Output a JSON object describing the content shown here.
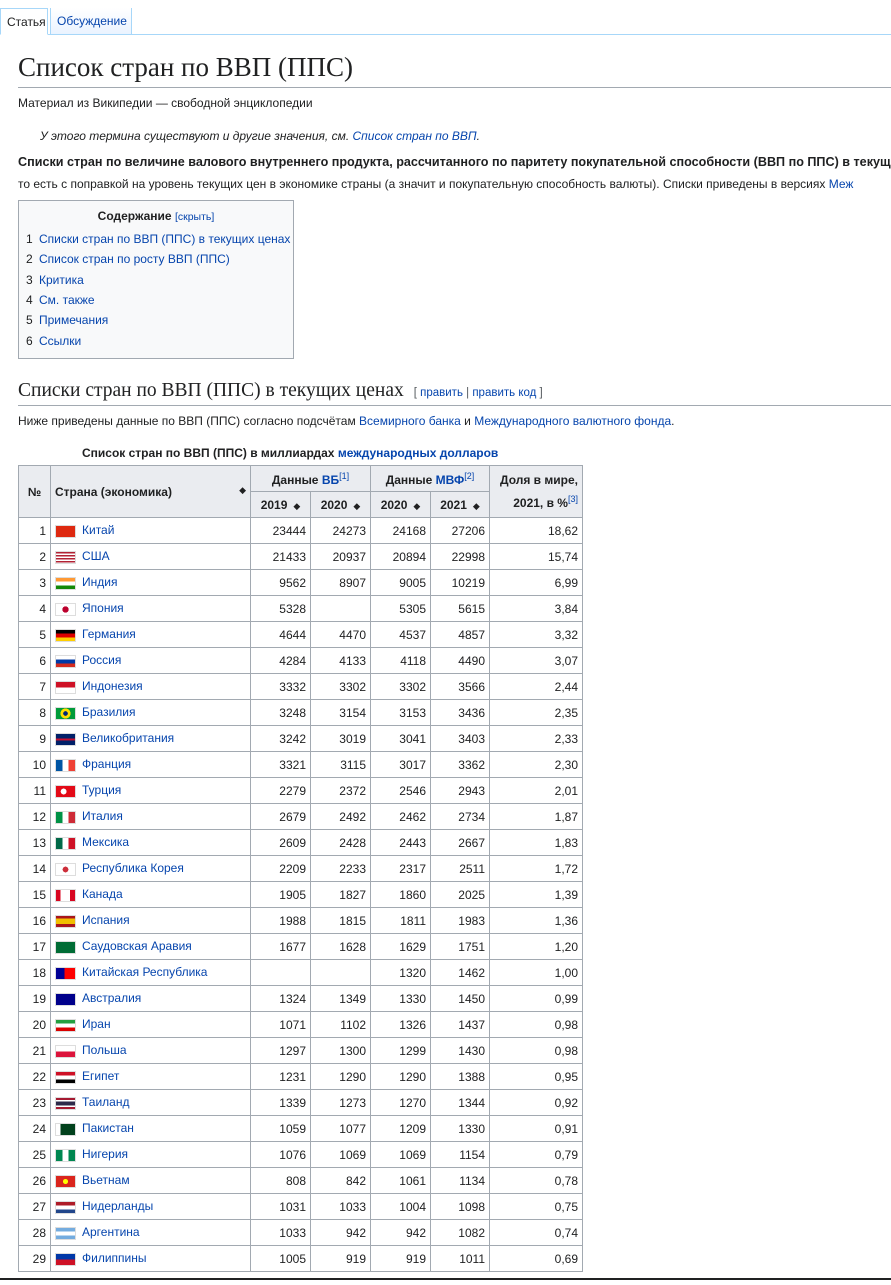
{
  "tabs": {
    "article": "Статья",
    "talk": "Обсуждение"
  },
  "title": "Список стран по ВВП (ППС)",
  "subtitle": "Материал из Википедии — свободной энциклопедии",
  "hatnote": {
    "text": "У этого термина существуют и другие значения, см. ",
    "link": "Список стран по ВВП",
    "end": "."
  },
  "lead": {
    "bold": "Списки стран по величине валового внутреннего продукта, рассчитанного по паритету покупательной способности (ВВП по ППС) в текущ",
    "line2": "то есть с поправкой на уровень текущих цен в экономике страны (а значит и покупательную способность валюты). Списки приведены в версиях ",
    "line2_link": "Меж"
  },
  "toc": {
    "title": "Содержание",
    "toggle": "[скрыть]",
    "items": [
      {
        "num": "1",
        "label": "Списки стран по ВВП (ППС) в текущих ценах"
      },
      {
        "num": "2",
        "label": "Список стран по росту ВВП (ППС)"
      },
      {
        "num": "3",
        "label": "Критика"
      },
      {
        "num": "4",
        "label": "См. также"
      },
      {
        "num": "5",
        "label": "Примечания"
      },
      {
        "num": "6",
        "label": "Ссылки"
      }
    ]
  },
  "section": {
    "heading": "Списки стран по ВВП (ППС) в текущих ценах",
    "edit_open": "[ ",
    "edit": "править",
    "sep": " | ",
    "edit_code": "править код",
    "edit_close": " ]",
    "para_start": "Ниже приведены данные по ВВП (ППС) согласно подсчётам ",
    "para_link1": "Всемирного банка",
    "para_mid": " и ",
    "para_link2": "Международного валютного фонда",
    "para_end": "."
  },
  "table": {
    "caption": "Список стран по ВВП (ППС) в миллиардах ",
    "caption_link": "международных долларов",
    "headers": {
      "num": "№",
      "country": "Страна (экономика)",
      "wb_prefix": "Данные ",
      "wb_link": "ВБ",
      "wb_ref": "[1]",
      "imf_prefix": "Данные ",
      "imf_link": "МВФ",
      "imf_ref": "[2]",
      "share": "Доля в мире, 2021, в %",
      "share_ref": "[3]",
      "y2019": "2019",
      "y2020a": "2020",
      "y2020b": "2020",
      "y2021": "2021"
    },
    "sort_icon": "◆",
    "rows": [
      {
        "n": "1",
        "country": "Китай",
        "flag": "cn",
        "wb2019": "23444",
        "wb2020": "24273",
        "imf2020": "24168",
        "imf2021": "27206",
        "share": "18,62"
      },
      {
        "n": "2",
        "country": "США",
        "flag": "us",
        "wb2019": "21433",
        "wb2020": "20937",
        "imf2020": "20894",
        "imf2021": "22998",
        "share": "15,74"
      },
      {
        "n": "3",
        "country": "Индия",
        "flag": "in",
        "wb2019": "9562",
        "wb2020": "8907",
        "imf2020": "9005",
        "imf2021": "10219",
        "share": "6,99"
      },
      {
        "n": "4",
        "country": "Япония",
        "flag": "jp",
        "wb2019": "5328",
        "wb2020": "",
        "imf2020": "5305",
        "imf2021": "5615",
        "share": "3,84"
      },
      {
        "n": "5",
        "country": "Германия",
        "flag": "de",
        "wb2019": "4644",
        "wb2020": "4470",
        "imf2020": "4537",
        "imf2021": "4857",
        "share": "3,32"
      },
      {
        "n": "6",
        "country": "Россия",
        "flag": "ru",
        "wb2019": "4284",
        "wb2020": "4133",
        "imf2020": "4118",
        "imf2021": "4490",
        "share": "3,07"
      },
      {
        "n": "7",
        "country": "Индонезия",
        "flag": "id",
        "wb2019": "3332",
        "wb2020": "3302",
        "imf2020": "3302",
        "imf2021": "3566",
        "share": "2,44"
      },
      {
        "n": "8",
        "country": "Бразилия",
        "flag": "br",
        "wb2019": "3248",
        "wb2020": "3154",
        "imf2020": "3153",
        "imf2021": "3436",
        "share": "2,35"
      },
      {
        "n": "9",
        "country": "Великобритания",
        "flag": "gb",
        "wb2019": "3242",
        "wb2020": "3019",
        "imf2020": "3041",
        "imf2021": "3403",
        "share": "2,33"
      },
      {
        "n": "10",
        "country": "Франция",
        "flag": "fr",
        "wb2019": "3321",
        "wb2020": "3115",
        "imf2020": "3017",
        "imf2021": "3362",
        "share": "2,30"
      },
      {
        "n": "11",
        "country": "Турция",
        "flag": "tr",
        "wb2019": "2279",
        "wb2020": "2372",
        "imf2020": "2546",
        "imf2021": "2943",
        "share": "2,01"
      },
      {
        "n": "12",
        "country": "Италия",
        "flag": "it",
        "wb2019": "2679",
        "wb2020": "2492",
        "imf2020": "2462",
        "imf2021": "2734",
        "share": "1,87"
      },
      {
        "n": "13",
        "country": "Мексика",
        "flag": "mx",
        "wb2019": "2609",
        "wb2020": "2428",
        "imf2020": "2443",
        "imf2021": "2667",
        "share": "1,83"
      },
      {
        "n": "14",
        "country": "Республика Корея",
        "flag": "kr",
        "wb2019": "2209",
        "wb2020": "2233",
        "imf2020": "2317",
        "imf2021": "2511",
        "share": "1,72"
      },
      {
        "n": "15",
        "country": "Канада",
        "flag": "ca",
        "wb2019": "1905",
        "wb2020": "1827",
        "imf2020": "1860",
        "imf2021": "2025",
        "share": "1,39"
      },
      {
        "n": "16",
        "country": "Испания",
        "flag": "es",
        "wb2019": "1988",
        "wb2020": "1815",
        "imf2020": "1811",
        "imf2021": "1983",
        "share": "1,36"
      },
      {
        "n": "17",
        "country": "Саудовская Аравия",
        "flag": "sa",
        "wb2019": "1677",
        "wb2020": "1628",
        "imf2020": "1629",
        "imf2021": "1751",
        "share": "1,20"
      },
      {
        "n": "18",
        "country": "Китайская Республика",
        "flag": "tw",
        "wb2019": "",
        "wb2020": "",
        "imf2020": "1320",
        "imf2021": "1462",
        "share": "1,00"
      },
      {
        "n": "19",
        "country": "Австралия",
        "flag": "au",
        "wb2019": "1324",
        "wb2020": "1349",
        "imf2020": "1330",
        "imf2021": "1450",
        "share": "0,99"
      },
      {
        "n": "20",
        "country": "Иран",
        "flag": "ir",
        "wb2019": "1071",
        "wb2020": "1102",
        "imf2020": "1326",
        "imf2021": "1437",
        "share": "0,98"
      },
      {
        "n": "21",
        "country": "Польша",
        "flag": "pl",
        "wb2019": "1297",
        "wb2020": "1300",
        "imf2020": "1299",
        "imf2021": "1430",
        "share": "0,98"
      },
      {
        "n": "22",
        "country": "Египет",
        "flag": "eg",
        "wb2019": "1231",
        "wb2020": "1290",
        "imf2020": "1290",
        "imf2021": "1388",
        "share": "0,95"
      },
      {
        "n": "23",
        "country": "Таиланд",
        "flag": "th",
        "wb2019": "1339",
        "wb2020": "1273",
        "imf2020": "1270",
        "imf2021": "1344",
        "share": "0,92"
      },
      {
        "n": "24",
        "country": "Пакистан",
        "flag": "pk",
        "wb2019": "1059",
        "wb2020": "1077",
        "imf2020": "1209",
        "imf2021": "1330",
        "share": "0,91"
      },
      {
        "n": "25",
        "country": "Нигерия",
        "flag": "ng",
        "wb2019": "1076",
        "wb2020": "1069",
        "imf2020": "1069",
        "imf2021": "1154",
        "share": "0,79"
      },
      {
        "n": "26",
        "country": "Вьетнам",
        "flag": "vn",
        "wb2019": "808",
        "wb2020": "842",
        "imf2020": "1061",
        "imf2021": "1134",
        "share": "0,78"
      },
      {
        "n": "27",
        "country": "Нидерланды",
        "flag": "nl",
        "wb2019": "1031",
        "wb2020": "1033",
        "imf2020": "1004",
        "imf2021": "1098",
        "share": "0,75"
      },
      {
        "n": "28",
        "country": "Аргентина",
        "flag": "ar",
        "wb2019": "1033",
        "wb2020": "942",
        "imf2020": "942",
        "imf2021": "1082",
        "share": "0,74"
      },
      {
        "n": "29",
        "country": "Филиппины",
        "flag": "ph",
        "wb2019": "1005",
        "wb2020": "919",
        "imf2020": "919",
        "imf2021": "1011",
        "share": "0,69"
      }
    ]
  }
}
